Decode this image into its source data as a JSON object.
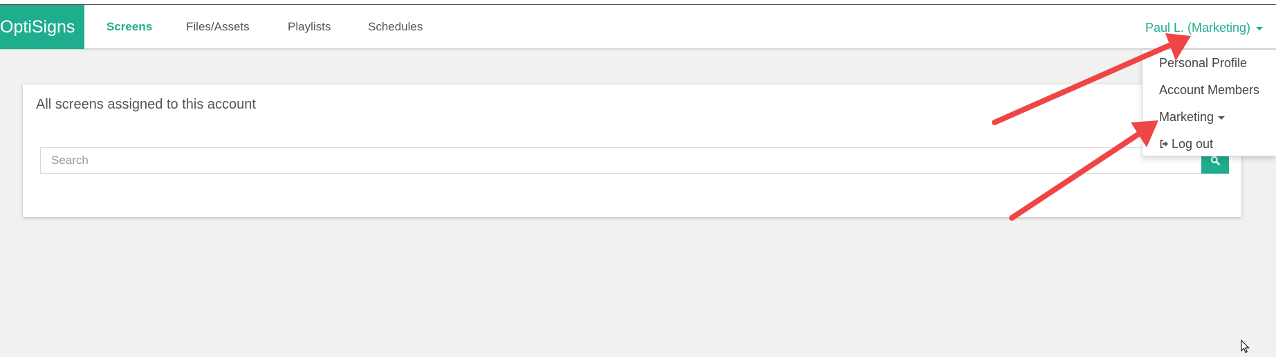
{
  "brand": {
    "name": "OptiSigns",
    "color": "#1fae8d"
  },
  "nav": {
    "links": [
      {
        "label": "Screens",
        "active": true
      },
      {
        "label": "Files/Assets",
        "active": false
      },
      {
        "label": "Playlists",
        "active": false
      },
      {
        "label": "Schedules",
        "active": false
      }
    ]
  },
  "user": {
    "label": "Paul L. (Marketing)",
    "icon": "caret-down-icon"
  },
  "dropdown": {
    "items": [
      {
        "label": "Personal Profile"
      },
      {
        "label": "Account Members"
      },
      {
        "label": "Marketing",
        "icon": "caret-down-icon"
      },
      {
        "label": "Log out",
        "icon": "logout-icon"
      }
    ]
  },
  "panel": {
    "title": "All screens assigned to this account",
    "search": {
      "placeholder": "Search",
      "value": "",
      "button_icon": "search-icon"
    }
  },
  "annotations": {
    "arrow_color": "#f04545"
  }
}
